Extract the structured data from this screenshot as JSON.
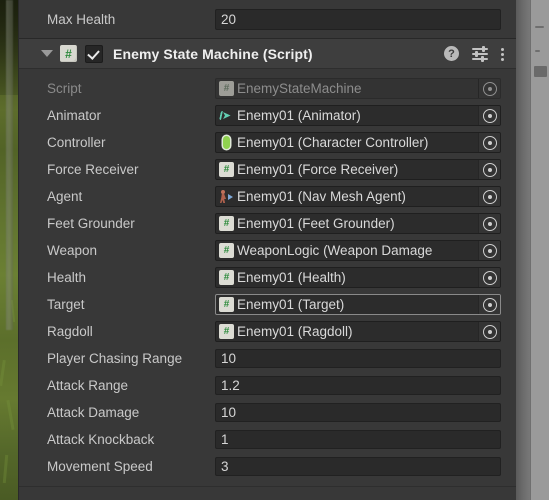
{
  "window": {
    "editor": "Unity Inspector",
    "panel_bg": "#383838",
    "header_bg": "#3e3e3e",
    "accent_green": "#8fd14f",
    "field_bg": "#2c2c2c"
  },
  "top_property": {
    "label": "Max Health",
    "value": "20"
  },
  "component": {
    "title": "Enemy State Machine (Script)",
    "expanded": true,
    "enabled": true,
    "script_icon": "csharp-script-icon",
    "foldout_icon": "triangle-down-icon",
    "header_icons": [
      {
        "name": "help-icon",
        "glyph": "?"
      },
      {
        "name": "preset-sliders-icon",
        "glyph": "sliders"
      },
      {
        "name": "kebab-menu-icon",
        "glyph": "kebab"
      }
    ]
  },
  "object_fields": [
    {
      "label": "Script",
      "value": "EnemyStateMachine",
      "icon": "csharp-script-icon",
      "disabled": true,
      "hovered": false
    },
    {
      "label": "Animator",
      "value": "Enemy01 (Animator)",
      "icon": "animator-icon",
      "disabled": false,
      "hovered": false
    },
    {
      "label": "Controller",
      "value": "Enemy01 (Character Controller)",
      "icon": "character-controller-capsule-icon",
      "disabled": false,
      "hovered": false
    },
    {
      "label": "Force Receiver",
      "value": "Enemy01 (Force Receiver)",
      "icon": "csharp-script-icon",
      "disabled": false,
      "hovered": false
    },
    {
      "label": "Agent",
      "value": "Enemy01 (Nav Mesh Agent)",
      "icon": "nav-mesh-agent-icon",
      "disabled": false,
      "hovered": false
    },
    {
      "label": "Feet Grounder",
      "value": "Enemy01 (Feet Grounder)",
      "icon": "csharp-script-icon",
      "disabled": false,
      "hovered": false
    },
    {
      "label": "Weapon",
      "value": "WeaponLogic (Weapon Damage",
      "icon": "csharp-script-icon",
      "disabled": false,
      "hovered": false
    },
    {
      "label": "Health",
      "value": "Enemy01 (Health)",
      "icon": "csharp-script-icon",
      "disabled": false,
      "hovered": false
    },
    {
      "label": "Target",
      "value": "Enemy01 (Target)",
      "icon": "csharp-script-icon",
      "disabled": false,
      "hovered": true
    },
    {
      "label": "Ragdoll",
      "value": "Enemy01 (Ragdoll)",
      "icon": "csharp-script-icon",
      "disabled": false,
      "hovered": false
    }
  ],
  "number_fields": [
    {
      "label": "Player Chasing Range",
      "value": "10"
    },
    {
      "label": "Attack Range",
      "value": "1.2"
    },
    {
      "label": "Attack Damage",
      "value": "10"
    },
    {
      "label": "Attack Knockback",
      "value": "1"
    },
    {
      "label": "Movement Speed",
      "value": "3"
    }
  ]
}
